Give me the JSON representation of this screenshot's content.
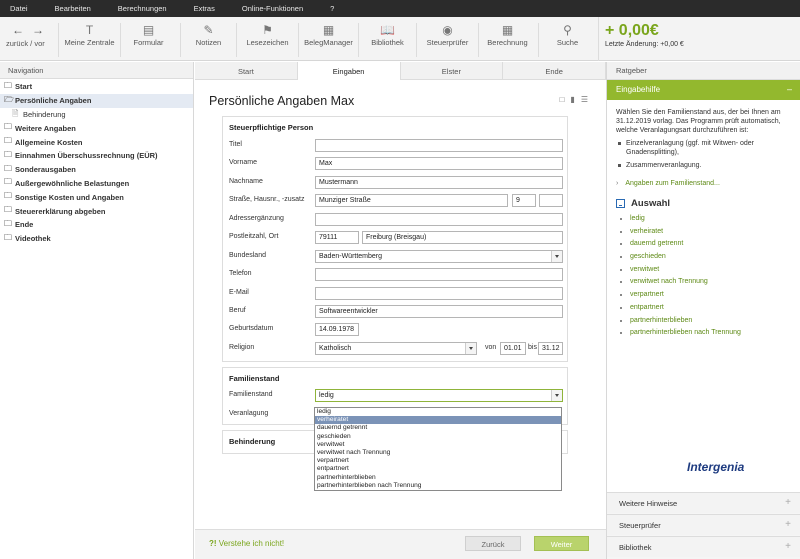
{
  "menu": [
    "Datei",
    "Bearbeiten",
    "Berechnungen",
    "Extras",
    "Online-Funktionen",
    "?"
  ],
  "toolbar": {
    "nav_label": "zurück / vor",
    "buttons": [
      {
        "label": "Meine Zentrale",
        "icon": "T-icon"
      },
      {
        "label": "Formular",
        "icon": "form-icon"
      },
      {
        "label": "Notizen",
        "icon": "pencil-icon"
      },
      {
        "label": "Lesezeichen",
        "icon": "bookmark-icon"
      },
      {
        "label": "BelegManager",
        "icon": "receipt-icon"
      },
      {
        "label": "Bibliothek",
        "icon": "book-icon"
      },
      {
        "label": "Steuerprüfer",
        "icon": "eye-icon"
      },
      {
        "label": "Berechnung",
        "icon": "calculator-icon"
      },
      {
        "label": "Suche",
        "icon": "search-icon"
      }
    ],
    "amount": "+ 0,00€",
    "last_change": "Letzte Änderung: +0,00 €"
  },
  "navigation": {
    "header": "Navigation",
    "items": [
      {
        "label": "Start",
        "active": false,
        "sub": false
      },
      {
        "label": "Persönliche Angaben",
        "active": true,
        "sub": false
      },
      {
        "label": "Behinderung",
        "active": false,
        "sub": true
      },
      {
        "label": "Weitere Angaben",
        "active": false,
        "sub": false
      },
      {
        "label": "Allgemeine Kosten",
        "active": false,
        "sub": false
      },
      {
        "label": "Einnahmen Überschussrechnung (EÜR)",
        "active": false,
        "sub": false
      },
      {
        "label": "Sonderausgaben",
        "active": false,
        "sub": false
      },
      {
        "label": "Außergewöhnliche Belastungen",
        "active": false,
        "sub": false
      },
      {
        "label": "Sonstige Kosten und Angaben",
        "active": false,
        "sub": false
      },
      {
        "label": "Steuererklärung abgeben",
        "active": false,
        "sub": false
      },
      {
        "label": "Ende",
        "active": false,
        "sub": false
      },
      {
        "label": "Videothek",
        "active": false,
        "sub": false
      }
    ]
  },
  "tabs": [
    "Start",
    "Eingaben",
    "Elster",
    "Ende"
  ],
  "main": {
    "title": "Persönliche Angaben Max",
    "sections": {
      "steuerpflichtige": "Steuerpflichtige Person",
      "familienstand": "Familienstand",
      "behinderung": "Behinderung"
    },
    "fields": {
      "titel_label": "Titel",
      "titel": "",
      "vorname_label": "Vorname",
      "vorname": "Max",
      "nachname_label": "Nachname",
      "nachname": "Mustermann",
      "strasse_label": "Straße, Hausnr., -zusatz",
      "strasse": "Munziger Straße",
      "hausnr": "9",
      "zusatz": "",
      "adress_label": "Adressergänzung",
      "adresse": "",
      "plz_label": "Postleitzahl, Ort",
      "plz": "79111",
      "ort": "Freiburg (Breisgau)",
      "bundesland_label": "Bundesland",
      "bundesland": "Baden-Württemberg",
      "telefon_label": "Telefon",
      "telefon": "",
      "email_label": "E-Mail",
      "email": "",
      "beruf_label": "Beruf",
      "beruf": "Softwareentwickler",
      "geburt_label": "Geburtsdatum",
      "geburt": "14.09.1978",
      "religion_label": "Religion",
      "religion": "Katholisch",
      "von_label": "von",
      "von": "01.01",
      "bis_label": "bis",
      "bis": "31.12",
      "familienstand_label": "Familienstand",
      "familienstand": "ledig",
      "veranlagung_label": "Veranlagung"
    },
    "dropdown_options": [
      "ledig",
      "verheiratet",
      "dauernd getrennt",
      "geschieden",
      "verwitwet",
      "verwitwet nach Trennung",
      "verpartnert",
      "entpartnert",
      "partnerhinterblieben",
      "partnerhinterblieben nach Trennung"
    ],
    "dropdown_highlight": 1,
    "understand": "Verstehe ich nicht!",
    "back": "Zurück",
    "next": "Weiter"
  },
  "rightpanel": {
    "header": "Ratgeber",
    "eingabehilfe": "Eingabehilfe",
    "text": "Wählen Sie den Familienstand aus, der bei Ihnen am 31.12.2019 vorlag. Das Programm prüft automatisch, welche Veranlagungsart durchzuführen ist:",
    "bullets": [
      "Einzelveranlagung (ggf. mit Witwen- oder Gnadensplitting),",
      "Zusammenveranlagung."
    ],
    "link": "Angaben zum Familienstand...",
    "auswahl": "Auswahl",
    "options": [
      "ledig",
      "verheiratet",
      "dauernd getrennt",
      "geschieden",
      "verwitwet",
      "verwitwet nach Trennung",
      "verpartnert",
      "entpartnert",
      "partnerhinterblieben",
      "partnerhinterblieben nach Trennung"
    ],
    "logo": "Intergenia",
    "accordion": [
      "Weitere Hinweise",
      "Steuerprüfer",
      "Bibliothek"
    ]
  }
}
